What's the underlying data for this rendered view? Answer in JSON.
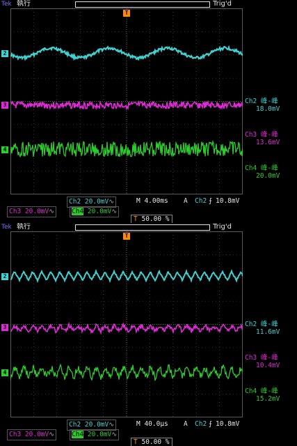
{
  "panels": [
    {
      "id": "p1",
      "run_label": "執行",
      "tek_label": "Tek",
      "trig_label": "Trig'd",
      "timebase": "M 4.00ms",
      "ch2_scale": "20.0mV",
      "ch3_scale": "20.0mV",
      "ch4_scale": "20.0mV",
      "trigger_source": "Ch2",
      "trigger_level": "10.8mV",
      "trigger_position": "50.00 %",
      "measurements": [
        {
          "label": "Ch2 峰-峰",
          "value": "18.0mV",
          "color": "#3fd2d2"
        },
        {
          "label": "Ch3 峰-峰",
          "value": "13.6mV",
          "color": "#e02ad8"
        },
        {
          "label": "Ch4 峰-峰",
          "value": "20.0mV",
          "color": "#2ccc2c"
        }
      ]
    },
    {
      "id": "p2",
      "run_label": "執行",
      "tek_label": "Tek",
      "trig_label": "Trig'd",
      "timebase": "M 40.0µs",
      "ch2_scale": "20.0mV",
      "ch3_scale": "20.0mV",
      "ch4_scale": "20.0mV",
      "trigger_source": "Ch2",
      "trigger_level": "10.8mV",
      "trigger_position": "50.00 %",
      "measurements": [
        {
          "label": "Ch2 峰-峰",
          "value": "11.6mV",
          "color": "#3fd2d2"
        },
        {
          "label": "Ch3 峰-峰",
          "value": "10.4mV",
          "color": "#e02ad8"
        },
        {
          "label": "Ch4 峰-峰",
          "value": "15.2mV",
          "color": "#2ccc2c"
        }
      ]
    }
  ],
  "channel_markers": {
    "ch2": "2",
    "ch3": "3",
    "ch4": "4"
  },
  "trigger_marker": "T",
  "colors": {
    "ch2": "#3fd2d2",
    "ch3": "#e02ad8",
    "ch4": "#2ccc2c",
    "trigger": "#ff8a00",
    "grid": "#5a5a5a"
  }
}
